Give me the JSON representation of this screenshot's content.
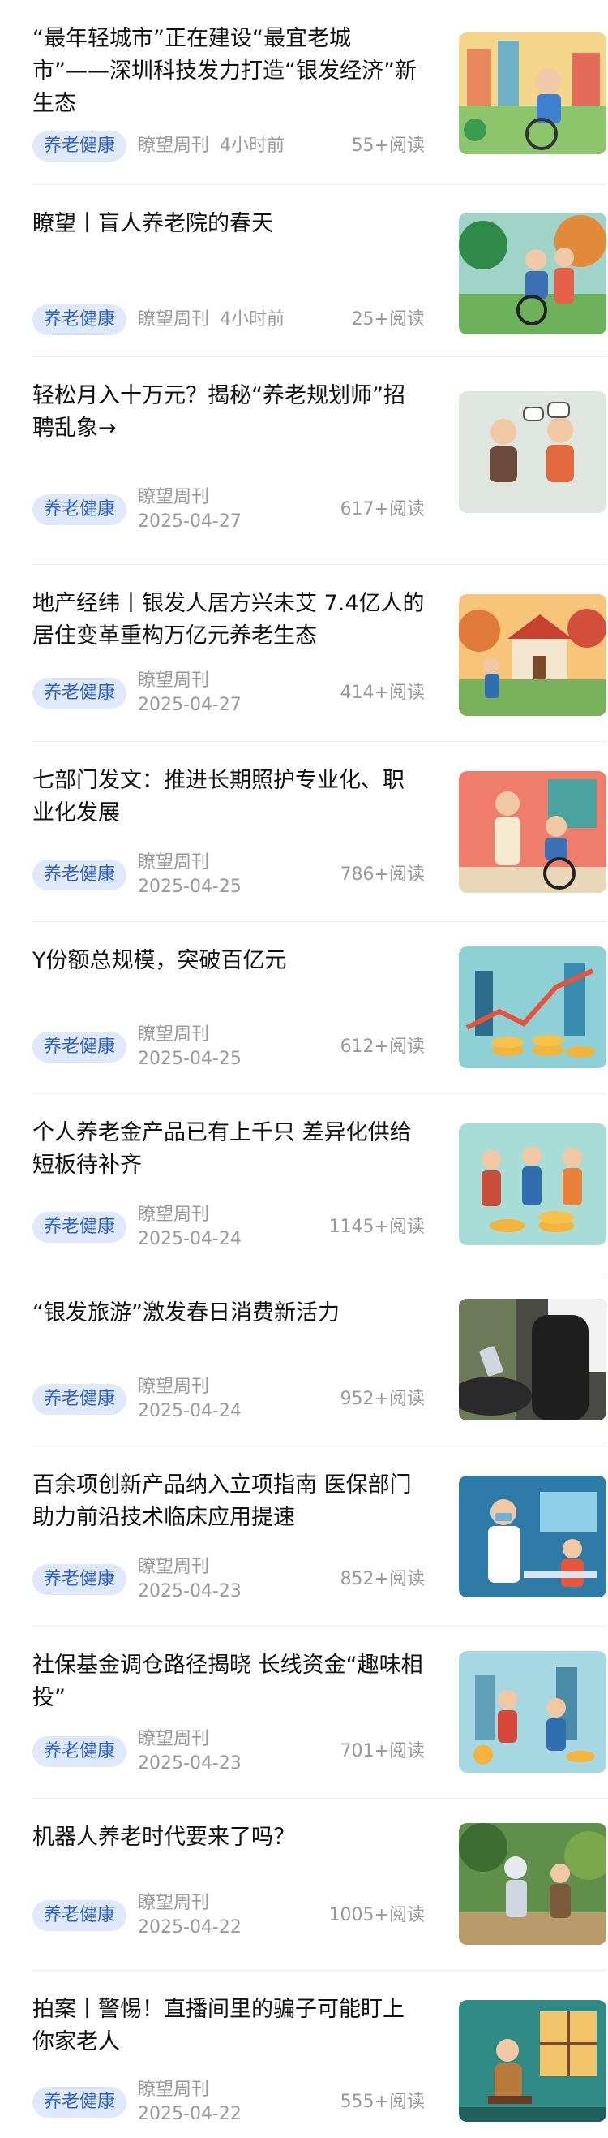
{
  "feed": {
    "items": [
      {
        "title": "“最年轻城市”正在建设“最宜老城市”——深圳科技发力打造“银发经济”新生态",
        "tag": "养老健康",
        "source": "瞭望周刊",
        "time": "4小时前",
        "reads": "55+阅读",
        "thumb": "elderly-wheelchair-city-icon"
      },
      {
        "title": "瞭望丨盲人养老院的春天",
        "tag": "养老健康",
        "source": "瞭望周刊",
        "time": "4小时前",
        "reads": "25+阅读",
        "thumb": "wheelchair-park-icon"
      },
      {
        "title": "轻松月入十万元？揭秘“养老规划师”招聘乱象→",
        "tag": "养老健康",
        "source": "瞭望周刊",
        "time": "2025-04-27",
        "reads": "617+阅读",
        "thumb": "elderly-couple-talking-icon"
      },
      {
        "title": "地产经纬丨银发人居方兴未艾 7.4亿人的居住变革重构万亿元养老生态",
        "tag": "养老健康",
        "source": "瞭望周刊",
        "time": "2025-04-27",
        "reads": "414+阅读",
        "thumb": "house-elderly-icon"
      },
      {
        "title": "七部门发文：推进长期照护专业化、职业化发展",
        "tag": "养老健康",
        "source": "瞭望周刊",
        "time": "2025-04-25",
        "reads": "786+阅读",
        "thumb": "caregiver-room-icon"
      },
      {
        "title": "Y份额总规模，突破百亿元",
        "tag": "养老健康",
        "source": "瞭望周刊",
        "time": "2025-04-25",
        "reads": "612+阅读",
        "thumb": "coins-chart-icon"
      },
      {
        "title": "个人养老金产品已有上千只 差异化供给短板待补齐",
        "tag": "养老健康",
        "source": "瞭望周刊",
        "time": "2025-04-24",
        "reads": "1145+阅读",
        "thumb": "people-coins-icon"
      },
      {
        "title": "“银发旅游”激发春日消费新活力",
        "tag": "养老健康",
        "source": "瞭望周刊",
        "time": "2025-04-24",
        "reads": "952+阅读",
        "thumb": "tourist-phone-icon"
      },
      {
        "title": "百余项创新产品纳入立项指南 医保部门助力前沿技术临床应用提速",
        "tag": "养老健康",
        "source": "瞭望周刊",
        "time": "2025-04-23",
        "reads": "852+阅读",
        "thumb": "doctor-lab-icon"
      },
      {
        "title": "社保基金调仓路径揭晓 长线资金“趣味相投”",
        "tag": "养老健康",
        "source": "瞭望周刊",
        "time": "2025-04-23",
        "reads": "701+阅读",
        "thumb": "investors-city-icon"
      },
      {
        "title": "机器人养老时代要来了吗？",
        "tag": "养老健康",
        "source": "瞭望周刊",
        "time": "2025-04-22",
        "reads": "1005+阅读",
        "thumb": "robot-garden-icon"
      },
      {
        "title": "拍案丨警惕！直播间里的骗子可能盯上你家老人",
        "tag": "养老健康",
        "source": "瞭望周刊",
        "time": "2025-04-22",
        "reads": "555+阅读",
        "thumb": "elderly-window-icon"
      }
    ]
  }
}
